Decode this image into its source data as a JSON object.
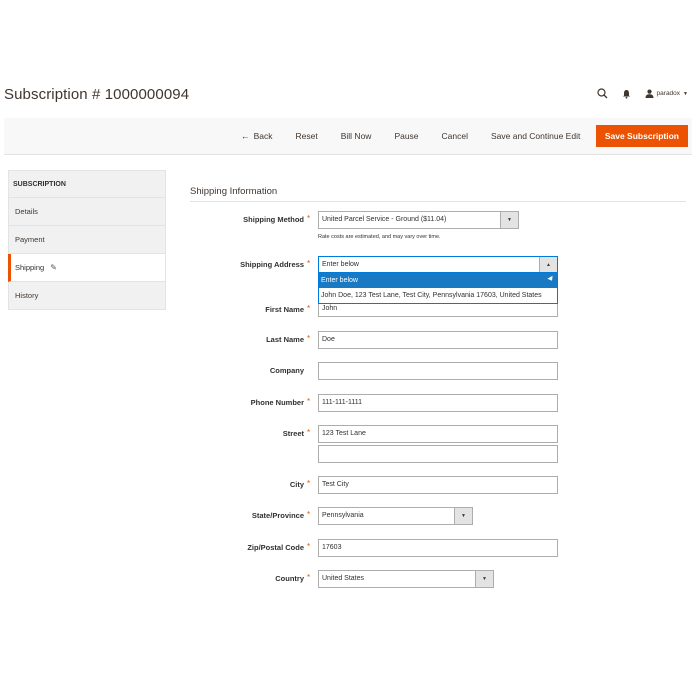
{
  "header": {
    "title": "Subscription # 1000000094",
    "user": "paradox"
  },
  "actions": {
    "back": "Back",
    "reset": "Reset",
    "bill_now": "Bill Now",
    "pause": "Pause",
    "cancel": "Cancel",
    "save_continue": "Save and Continue Edit",
    "save": "Save Subscription"
  },
  "sidebar": {
    "heading": "SUBSCRIPTION",
    "items": [
      {
        "label": "Details"
      },
      {
        "label": "Payment"
      },
      {
        "label": "Shipping"
      },
      {
        "label": "History"
      }
    ]
  },
  "section": {
    "title": "Shipping Information"
  },
  "form": {
    "shipping_method": {
      "label": "Shipping Method",
      "value": "United Parcel Service - Ground ($11.04)",
      "note": "Rate costs are estimated, and may vary over time."
    },
    "shipping_address": {
      "label": "Shipping Address",
      "value": "Enter below",
      "options": [
        "Enter below",
        "John Doe, 123 Test Lane, Test City, Pennsylvania 17603, United States"
      ]
    },
    "first_name": {
      "label": "First Name",
      "value": "John"
    },
    "last_name": {
      "label": "Last Name",
      "value": "Doe"
    },
    "company": {
      "label": "Company",
      "value": ""
    },
    "phone": {
      "label": "Phone Number",
      "value": "111-111-1111"
    },
    "street": {
      "label": "Street",
      "value": "123 Test Lane",
      "value2": ""
    },
    "city": {
      "label": "City",
      "value": "Test City"
    },
    "state": {
      "label": "State/Province",
      "value": "Pennsylvania"
    },
    "zip": {
      "label": "Zip/Postal Code",
      "value": "17603"
    },
    "country": {
      "label": "Country",
      "value": "United States"
    }
  },
  "colors": {
    "accent": "#eb5202",
    "selected_option": "#1979c3"
  },
  "icons": {
    "search": "search-icon",
    "notifications": "bell-icon",
    "account": "user-icon"
  }
}
